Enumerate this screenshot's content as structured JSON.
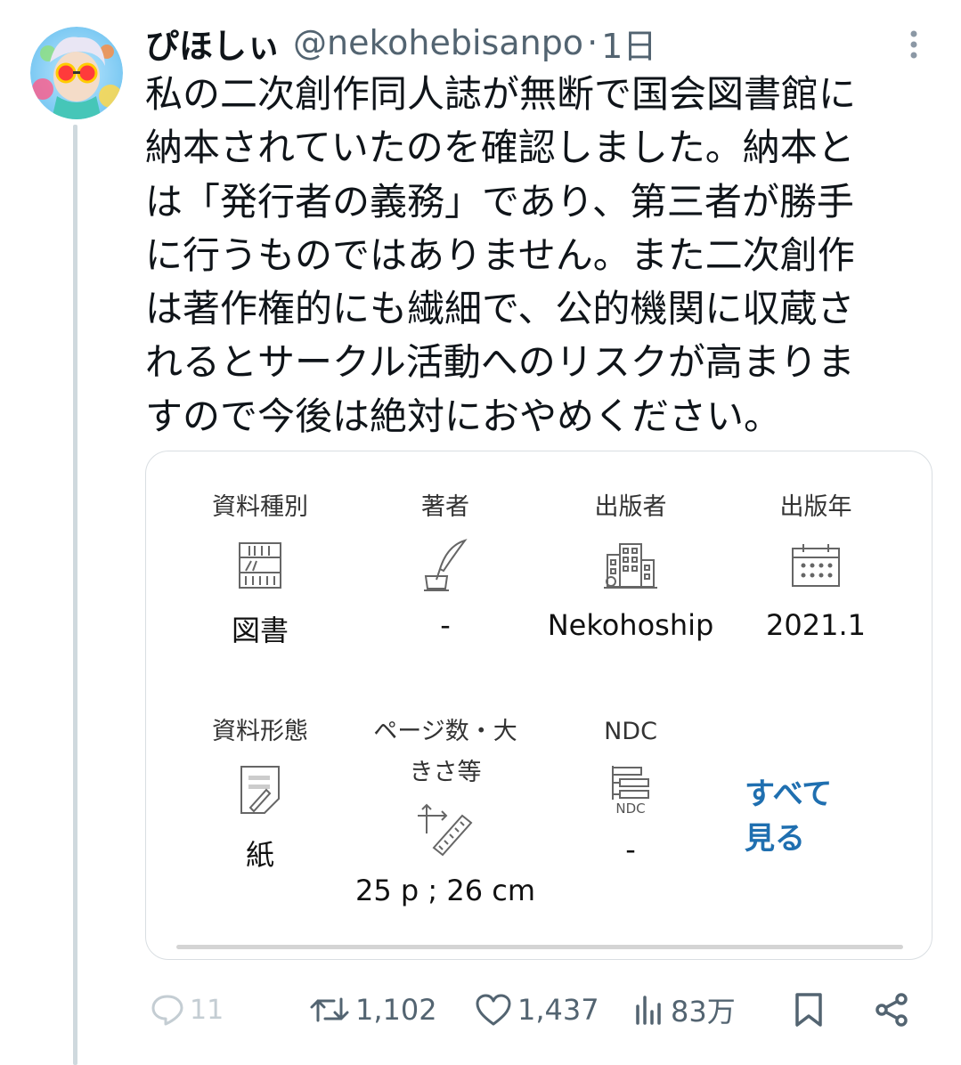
{
  "user": {
    "display_name": "ぴほしぃ",
    "handle": "@nekohebisanpo",
    "separator": "·",
    "time": "1日"
  },
  "tweet_lines": [
    "私の二次創作同人誌が無断で国会図書館に",
    "納本されていたのを確認しました。納本と",
    "は「発行者の義務」であり、第三者が勝手",
    "に行うものではありません。また二次創作",
    "は著作権的にも繊細で、公的機関に収蔵さ",
    "れるとサークル活動へのリスクが高まりま",
    "すので今後は絶対におやめください。"
  ],
  "card": {
    "fields": [
      {
        "label": "資料種別",
        "icon": "bookshelf-icon",
        "value": "図書"
      },
      {
        "label": "著者",
        "icon": "quill-pen-icon",
        "value": "-"
      },
      {
        "label": "出版者",
        "icon": "buildings-icon",
        "value": "Nekohoship"
      },
      {
        "label": "出版年",
        "icon": "calendar-icon",
        "value": "2021.1"
      },
      {
        "label": "資料形態",
        "icon": "document-icon",
        "value": "紙"
      },
      {
        "label_line1": "ページ数・大",
        "label_line2": "きさ等",
        "icon": "ruler-icon",
        "value": "25 p ; 26 cm"
      },
      {
        "label": "NDC",
        "icon": "ndc-icon",
        "icon_text": "NDC",
        "value": "-"
      }
    ],
    "see_all_line1": "すべて",
    "see_all_line2": "見る"
  },
  "actions": {
    "replies": "11",
    "retweets": "1,102",
    "likes": "1,437",
    "views": "83万"
  },
  "colors": {
    "text": "#0f1419",
    "muted": "#536471",
    "link": "#1f6fb0",
    "thread_line": "#cfd9de"
  }
}
